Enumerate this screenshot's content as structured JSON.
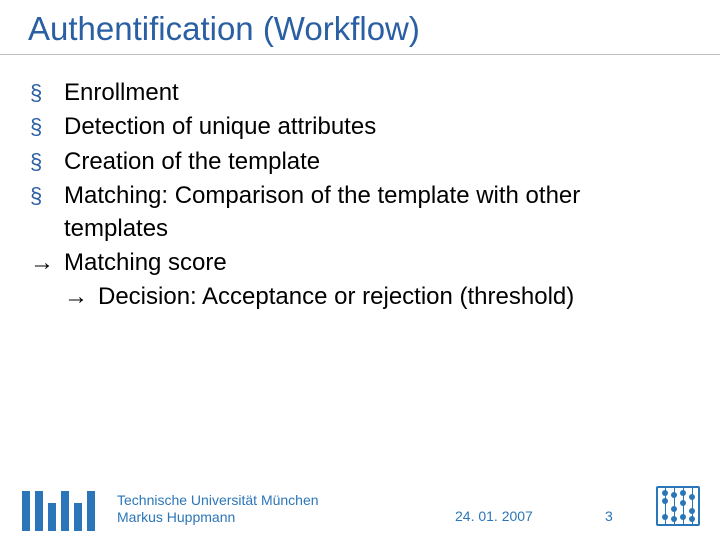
{
  "title": "Authentification (Workflow)",
  "bullets": {
    "b1": "Enrollment",
    "b2": "Detection of unique attributes",
    "b3": "Creation of the template",
    "b4": "Matching: Comparison of the template with other templates",
    "a1": "Matching score",
    "a2": "Decision: Acceptance or rejection (threshold)"
  },
  "footer": {
    "org": "Technische Universität München",
    "author": "Markus Huppmann",
    "date": "24. 01. 2007",
    "page": "3"
  }
}
